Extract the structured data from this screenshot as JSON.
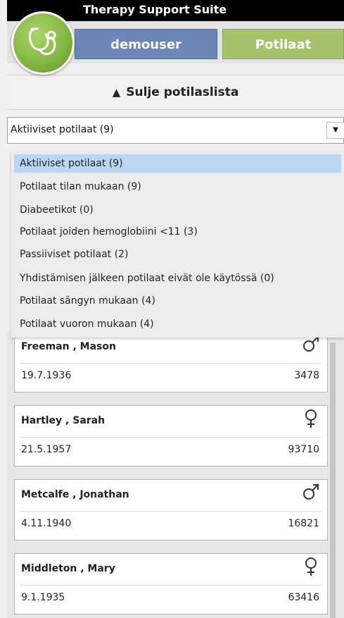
{
  "app": {
    "title": "Therapy Support Suite"
  },
  "header": {
    "user_button": "demouser",
    "patients_button": "Potilaat"
  },
  "close_list": {
    "label": "Sulje potilaslista"
  },
  "patient_filter": {
    "selected": "Aktiiviset potilaat (9)",
    "options": [
      "Aktiiviset potilaat (9)",
      "Potilaat tilan mukaan (9)",
      "Diabeetikot (0)",
      "Potilaat joiden hemoglobiini <11 (3)",
      "Passiiviset potilaat (2)",
      "Yhdistämisen jälkeen potilaat eivät ole käytössä (0)",
      "Potilaat sängyn mukaan (4)",
      "Potilaat vuoron mukaan (4)"
    ]
  },
  "patients": [
    {
      "name": "Freeman , Mason",
      "dob": "19.7.1936",
      "id": "3478",
      "gender": "male-icon"
    },
    {
      "name": "Hartley , Sarah",
      "dob": "21.5.1957",
      "id": "93710",
      "gender": "female-icon"
    },
    {
      "name": "Metcalfe , Jonathan",
      "dob": "4.11.1940",
      "id": "16821",
      "gender": "male-icon"
    },
    {
      "name": "Middleton , Mary",
      "dob": "9.1.1935",
      "id": "63416",
      "gender": "female-icon"
    }
  ],
  "colors": {
    "user_button": "#6b86b7",
    "patients_button": "#a6c36c",
    "logo": "#86b844",
    "selected_option": "#bcd7f4"
  }
}
